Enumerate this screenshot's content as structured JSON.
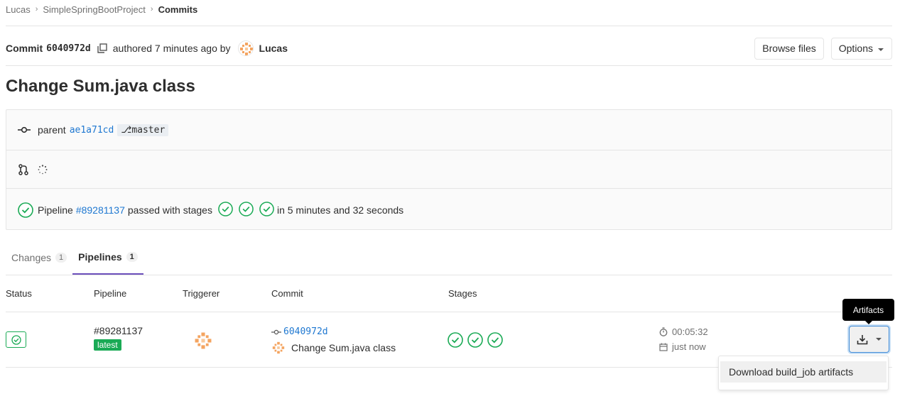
{
  "breadcrumb": {
    "items": [
      "Lucas",
      "SimpleSpringBootProject"
    ],
    "current": "Commits"
  },
  "commit": {
    "label": "Commit",
    "sha": "6040972d",
    "authored": "authored 7 minutes ago by",
    "author": "Lucas",
    "browse_files": "Browse files",
    "options": "Options",
    "title": "Change Sum.java class",
    "parent_label": "parent",
    "parent_sha": "ae1a71cd",
    "branch": "master"
  },
  "pipeline_info": {
    "prefix": "Pipeline",
    "id": "#89281137",
    "passed_text": "passed with stages",
    "duration_text": "in 5 minutes and 32 seconds"
  },
  "tabs": [
    {
      "label": "Changes",
      "count": "1"
    },
    {
      "label": "Pipelines",
      "count": "1"
    }
  ],
  "table": {
    "headers": {
      "status": "Status",
      "pipeline": "Pipeline",
      "triggerer": "Triggerer",
      "commit": "Commit",
      "stages": "Stages"
    },
    "row": {
      "pipeline_id": "#89281137",
      "badge": "latest",
      "commit_sha": "6040972d",
      "commit_title": "Change Sum.java class",
      "duration": "00:05:32",
      "finished": "just now"
    }
  },
  "tooltip": "Artifacts",
  "dropdown": {
    "item": "Download build_job artifacts"
  },
  "colors": {
    "success": "#1aaa55",
    "link": "#1f78d1",
    "tab_active": "#6b4fbb"
  },
  "icons": [
    "copy-icon",
    "commit-icon",
    "branch-icon",
    "merge-request-icon",
    "loading-spinner-icon",
    "check-circle-icon",
    "timer-icon",
    "calendar-icon",
    "download-icon",
    "caret-down-icon"
  ]
}
